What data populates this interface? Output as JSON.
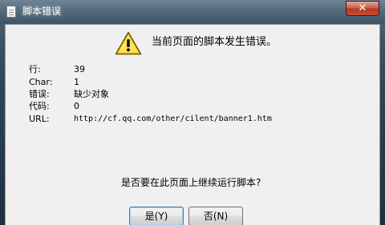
{
  "window": {
    "title": "脚本错误",
    "close_label": "✕"
  },
  "message": "当前页面的脚本发生错误。",
  "details": [
    {
      "label": "行:",
      "value": "39"
    },
    {
      "label": "Char:",
      "value": "1"
    },
    {
      "label": "错误:",
      "value": "缺少对象"
    },
    {
      "label": "代码:",
      "value": "0"
    },
    {
      "label": "URL:",
      "value": "http://cf.qq.com/other/cilent/banner1.htm"
    }
  ],
  "question": "是否要在此页面上继续运行脚本?",
  "buttons": {
    "yes": "是(Y)",
    "no": "否(N)"
  },
  "icons": {
    "title": "document-icon",
    "warning": "warning-icon",
    "close": "close-icon"
  }
}
